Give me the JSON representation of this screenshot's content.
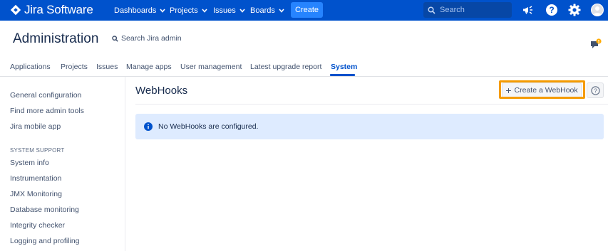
{
  "topnav": {
    "logo_text": "Jira Software",
    "items": [
      {
        "label": "Dashboards"
      },
      {
        "label": "Projects"
      },
      {
        "label": "Issues"
      },
      {
        "label": "Boards"
      }
    ],
    "create_label": "Create",
    "search_placeholder": "Search",
    "icons": [
      "megaphone-icon",
      "help-icon",
      "settings-gear-icon",
      "user-avatar"
    ],
    "colors": {
      "bar": "#0052cc",
      "create_button": "#2684ff",
      "search_bg": "#0747a6"
    }
  },
  "admin": {
    "title": "Administration",
    "search_label": "Search Jira admin"
  },
  "tabs": [
    {
      "label": "Applications"
    },
    {
      "label": "Projects"
    },
    {
      "label": "Issues"
    },
    {
      "label": "Manage apps"
    },
    {
      "label": "User management"
    },
    {
      "label": "Latest upgrade report"
    },
    {
      "label": "System",
      "active": true
    }
  ],
  "sidebar": {
    "items_top": [
      {
        "label": "General configuration"
      },
      {
        "label": "Find more admin tools"
      },
      {
        "label": "Jira mobile app"
      }
    ],
    "section_heading": "SYSTEM SUPPORT",
    "items_support": [
      {
        "label": "System info"
      },
      {
        "label": "Instrumentation"
      },
      {
        "label": "JMX Monitoring"
      },
      {
        "label": "Database monitoring"
      },
      {
        "label": "Integrity checker"
      },
      {
        "label": "Logging and profiling"
      }
    ]
  },
  "main": {
    "title": "WebHooks",
    "create_button_label": "Create a WebHook",
    "info_message": "No WebHooks are configured.",
    "highlight_color": "#f59b00"
  }
}
